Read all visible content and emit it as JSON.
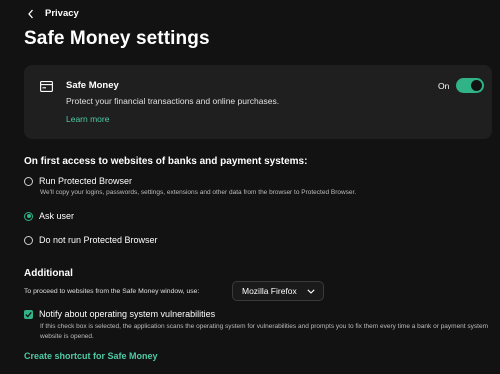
{
  "header": {
    "back_label": "Privacy",
    "title": "Safe Money settings"
  },
  "safe_money_card": {
    "title": "Safe Money",
    "description": "Protect your financial transactions and online purchases.",
    "learn_more": "Learn more",
    "toggle_label": "On",
    "toggle_on": true,
    "icon": "browser-window-icon"
  },
  "first_access": {
    "heading": "On first access to websites of banks and payment systems:",
    "options": [
      {
        "label": "Run Protected Browser",
        "description": "We'll copy your logins, passwords, settings, extensions and other data from the browser to Protected Browser.",
        "selected": false
      },
      {
        "label": "Ask user",
        "selected": true
      },
      {
        "label": "Do not run Protected Browser",
        "selected": false
      }
    ]
  },
  "additional": {
    "heading": "Additional",
    "proceed_text": "To proceed to websites from the Safe Money window, use:",
    "browser_selected": "Mozilla Firefox",
    "notify_label": "Notify about operating system vulnerabilities",
    "notify_checked": true,
    "notify_description": "If this check box is selected, the application scans the operating system for vulnerabilities and prompts you to fix them every time a bank or payment system website is opened.",
    "shortcut_link": "Create shortcut for Safe Money"
  },
  "colors": {
    "background": "#121212",
    "card": "#1f1f1f",
    "accent": "#2fb387",
    "link": "#4ec9a5"
  }
}
